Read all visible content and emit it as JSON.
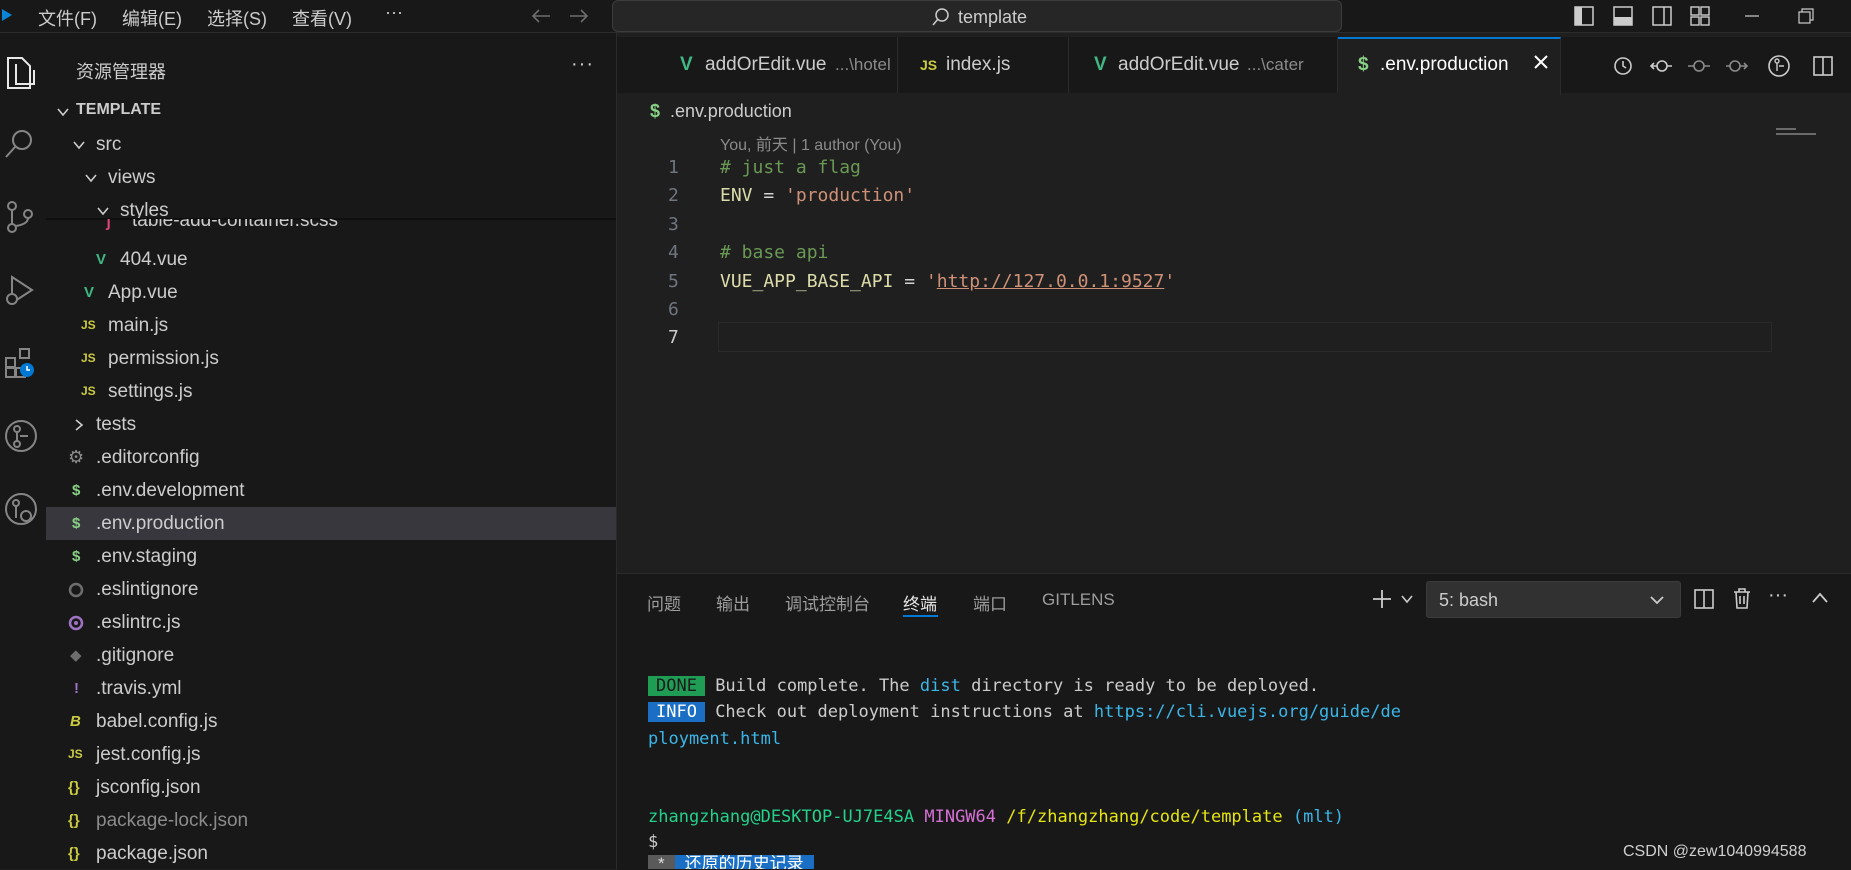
{
  "menu": {
    "file": "文件(F)",
    "edit": "编辑(E)",
    "selection": "选择(S)",
    "view": "查看(V)",
    "more": "···"
  },
  "search": {
    "label": "template"
  },
  "sidebar": {
    "header": "资源管理器",
    "more": "···",
    "section_title": "TEMPLATE",
    "tree": {
      "src": "src",
      "views": "views",
      "styles": "styles",
      "scss_file": "table-add-container.scss",
      "f404": "404.vue",
      "app": "App.vue",
      "main": "main.js",
      "permission": "permission.js",
      "settings": "settings.js",
      "tests": "tests",
      "editorconfig": ".editorconfig",
      "env_dev": ".env.development",
      "env_prod": ".env.production",
      "env_staging": ".env.staging",
      "eslintignore": ".eslintignore",
      "eslintrc": ".eslintrc.js",
      "gitignore": ".gitignore",
      "travis": ".travis.yml",
      "babel": "babel.config.js",
      "jest": "jest.config.js",
      "jsconfig": "jsconfig.json",
      "pkglock": "package-lock.json",
      "pkg": "package.json"
    }
  },
  "tabs": [
    {
      "name": "addOrEdit.vue",
      "path": "...\\hotel"
    },
    {
      "name": "index.js",
      "path": ""
    },
    {
      "name": "addOrEdit.vue",
      "path": "...\\cater"
    },
    {
      "name": ".env.production",
      "path": ""
    }
  ],
  "editor": {
    "breadcrumb": ".env.production",
    "blame": "You, 前天 | 1 author (You)",
    "line_numbers": [
      "1",
      "2",
      "3",
      "4",
      "5",
      "6",
      "7"
    ],
    "lines": {
      "l1": "# just a flag",
      "l2_key": "ENV",
      "l2_op": " = ",
      "l2_val": "'production'",
      "l4": "# base api",
      "l5_key": "VUE_APP_BASE_API",
      "l5_op": " = ",
      "l5_q1": "'",
      "l5_url": "http://127.0.0.1:9527",
      "l5_q2": "'"
    }
  },
  "panel": {
    "tabs": {
      "problems": "问题",
      "output": "输出",
      "debug": "调试控制台",
      "terminal": "终端",
      "ports": "端口",
      "gitlens": "GITLENS"
    },
    "terminal_select": "5: bash",
    "terminal": {
      "done_badge": "DONE",
      "done_text_1": " Build complete. The ",
      "done_dist": "dist",
      "done_text_2": " directory is ready to be deployed.",
      "info_badge": "INFO",
      "info_text": " Check out deployment instructions at ",
      "info_url_1": "https://cli.vuejs.org/guide/de",
      "info_url_2": "ployment.html",
      "prompt_user": "zhangzhang@DESKTOP-UJ7E4SA",
      "prompt_env": "MINGW64",
      "prompt_path": "/f/zhangzhang/code/template",
      "prompt_branch": "(mlt)",
      "prompt_dollar": "$",
      "history_star": "*",
      "history_text": "还原的历史记录"
    }
  },
  "watermark": "CSDN @zew1040994588",
  "colors": {
    "accent": "#0078d4",
    "vue_green": "#41b883",
    "js_yellow": "#cbcb41",
    "comment": "#6a9955",
    "string": "#ce9178",
    "variable": "#9cdcfe"
  }
}
